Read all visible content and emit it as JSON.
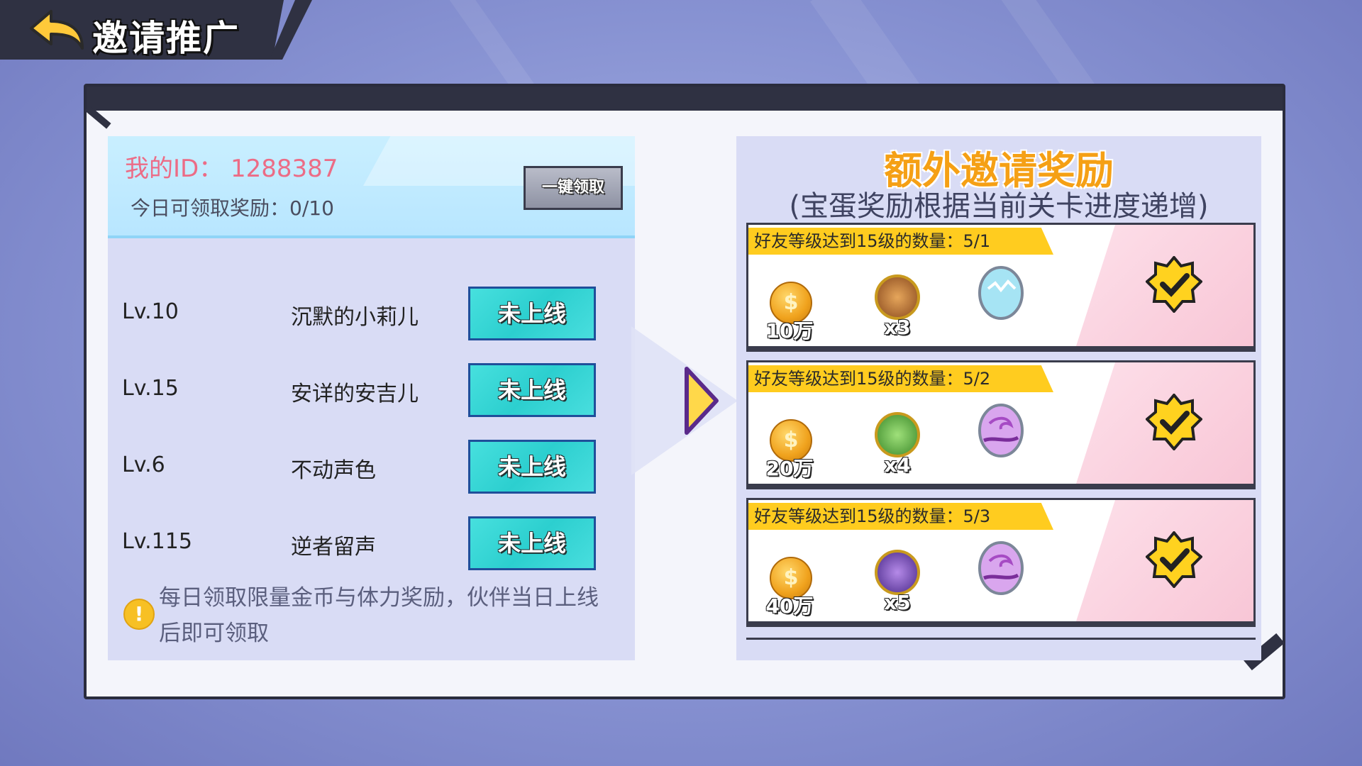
{
  "header": {
    "title": "邀请推广",
    "back_icon": "back-arrow-icon"
  },
  "left": {
    "my_id_label": "我的ID：",
    "my_id_value": "1288387",
    "my_id_text": "我的ID：  1288387",
    "today_text": "今日可领取奖励：0/10",
    "claim_all_label": "一键领取",
    "friends": [
      {
        "level": "Lv.10",
        "name": "沉默的小莉儿",
        "status": "未上线"
      },
      {
        "level": "Lv.15",
        "name": "安详的安吉儿",
        "status": "未上线"
      },
      {
        "level": "Lv.6",
        "name": "不动声色",
        "status": "未上线"
      },
      {
        "level": "Lv.115",
        "name": "逆者留声",
        "status": "未上线"
      }
    ],
    "notice": "每日领取限量金币与体力奖励，伙伴当日上线后即可领取"
  },
  "right": {
    "title": "额外邀请奖励",
    "subtitle": "(宝蛋奖励根据当前关卡进度递增)",
    "rewards": [
      {
        "label": "好友等级达到15级的数量：5/1",
        "coin": "10万",
        "hero_qty": "x3",
        "egg": "blue-egg",
        "claimed": true
      },
      {
        "label": "好友等级达到15级的数量：5/2",
        "coin": "20万",
        "hero_qty": "x4",
        "egg": "purple-egg",
        "claimed": true
      },
      {
        "label": "好友等级达到15级的数量：5/3",
        "coin": "40万",
        "hero_qty": "x5",
        "egg": "purple-egg",
        "claimed": true
      }
    ]
  },
  "colors": {
    "accent_orange": "#f5a015",
    "status_cyan": "#2ccfcf",
    "label_yellow": "#ffcc1f",
    "id_pink": "#ec6c86"
  }
}
